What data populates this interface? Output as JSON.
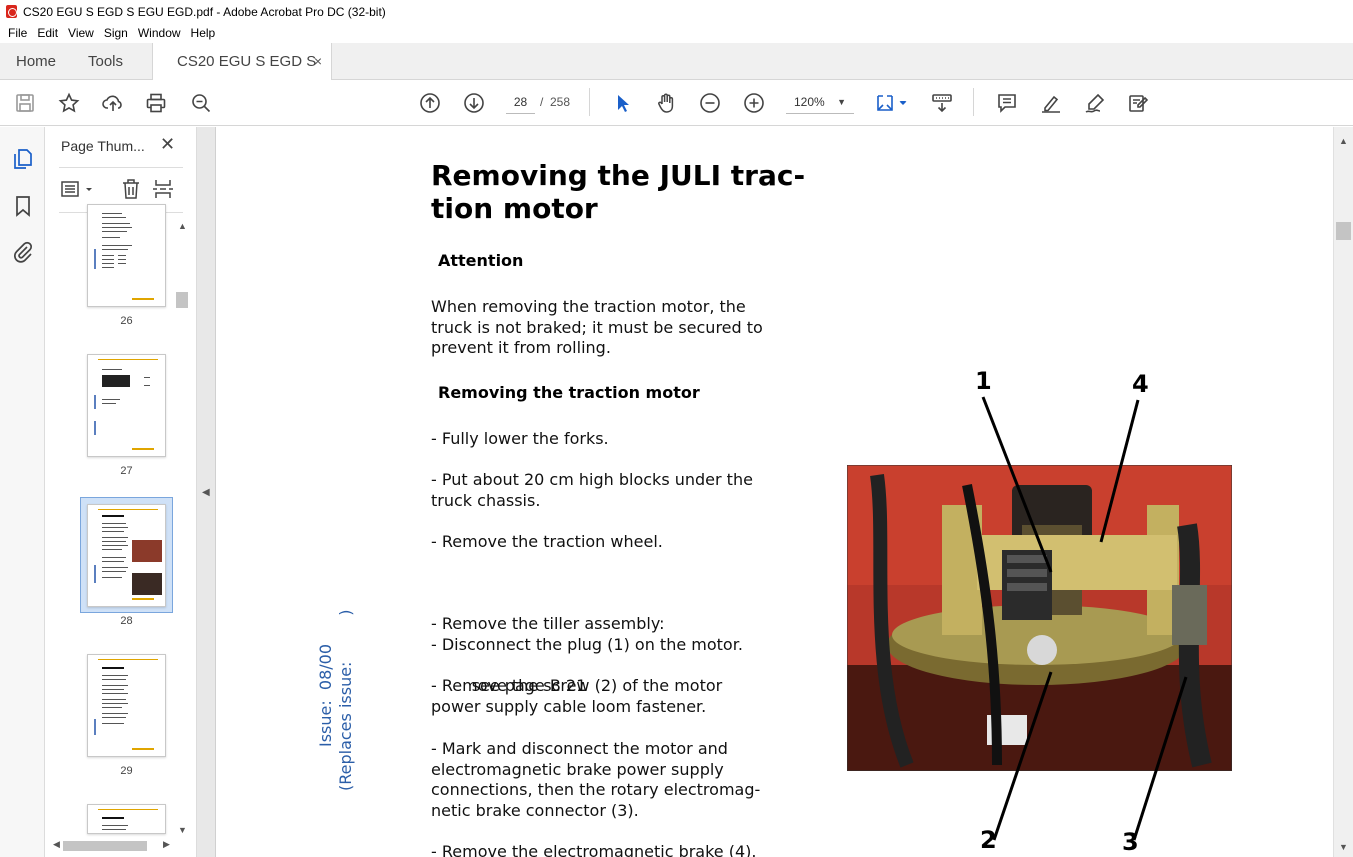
{
  "window": {
    "title": "CS20 EGU S EGD S EGU EGD.pdf - Adobe Acrobat Pro DC (32-bit)"
  },
  "menu": [
    "File",
    "Edit",
    "View",
    "Sign",
    "Window",
    "Help"
  ],
  "tabs": {
    "home": "Home",
    "tools": "Tools",
    "document": "CS20 EGU S EGD S ...",
    "close": "×"
  },
  "toolbar": {
    "page_current": "28",
    "page_sep": "/",
    "page_total": "258",
    "zoom": "120%",
    "icons": [
      "save-icon",
      "star-icon",
      "upload-icon",
      "print-icon",
      "search-zoom-icon",
      "page-up-icon",
      "page-down-icon",
      "select-arrow-icon",
      "hand-icon",
      "zoom-out-icon",
      "zoom-in-icon",
      "fit-page-icon",
      "scroll-mode-icon",
      "comment-icon",
      "highlight-icon",
      "sign-icon",
      "fill-sign-icon"
    ]
  },
  "thumbnails": {
    "title": "Page Thum...",
    "close": "✕",
    "pages": [
      "26",
      "27",
      "28",
      "29"
    ],
    "selected": "28"
  },
  "document": {
    "title": "Removing the JULI trac-tion motor",
    "title_line1": "Removing the JULI trac-",
    "title_line2": "tion motor",
    "attention_heading": "Attention",
    "attention_text": "When removing the traction motor, the truck is not braked; it must be secured to prevent it from rolling.",
    "attention_lines": [
      "When removing the traction motor, the",
      "truck is not braked; it must be secured to",
      "prevent it from rolling."
    ],
    "removing_heading": "Removing the traction motor",
    "steps": [
      [
        "- Fully lower the forks."
      ],
      [
        "- Put about 20 cm high blocks under the",
        "truck chassis."
      ],
      [
        "- Remove the traction wheel."
      ],
      [
        "- Remove the tiller assembly:",
        "        see page B 21"
      ],
      [
        "- Disconnect the plug (1) on the motor."
      ],
      [
        "- Remove the screw (2) of the motor",
        "power supply cable loom fastener."
      ],
      [
        "- Mark and disconnect the motor and",
        "electromagnetic brake power supply",
        "connections, then the rotary electromag-",
        "netic brake connector (3)."
      ],
      [
        "- Remove the electromagnetic brake (4)."
      ]
    ],
    "issue": "Issue:  08/00",
    "replaces": "(Replaces issue:         )",
    "callouts": [
      "1",
      "4",
      "2",
      "3"
    ]
  }
}
